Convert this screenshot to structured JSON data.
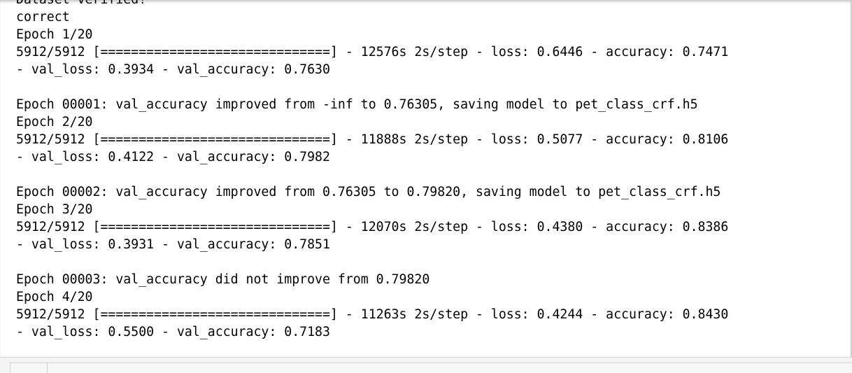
{
  "output": {
    "lines": [
      "Dataset verified!",
      "correct",
      "Epoch 1/20",
      "5912/5912 [==============================] - 12576s 2s/step - loss: 0.6446 - accuracy: 0.7471",
      "- val_loss: 0.3934 - val_accuracy: 0.7630",
      "",
      "Epoch 00001: val_accuracy improved from -inf to 0.76305, saving model to pet_class_crf.h5",
      "Epoch 2/20",
      "5912/5912 [==============================] - 11888s 2s/step - loss: 0.5077 - accuracy: 0.8106",
      "- val_loss: 0.4122 - val_accuracy: 0.7982",
      "",
      "Epoch 00002: val_accuracy improved from 0.76305 to 0.79820, saving model to pet_class_crf.h5",
      "Epoch 3/20",
      "5912/5912 [==============================] - 12070s 2s/step - loss: 0.4380 - accuracy: 0.8386",
      "- val_loss: 0.3931 - val_accuracy: 0.7851",
      "",
      "Epoch 00003: val_accuracy did not improve from 0.79820",
      "Epoch 4/20",
      "5912/5912 [==============================] - 11263s 2s/step - loss: 0.4244 - accuracy: 0.8430",
      "- val_loss: 0.5500 - val_accuracy: 0.7183"
    ]
  }
}
